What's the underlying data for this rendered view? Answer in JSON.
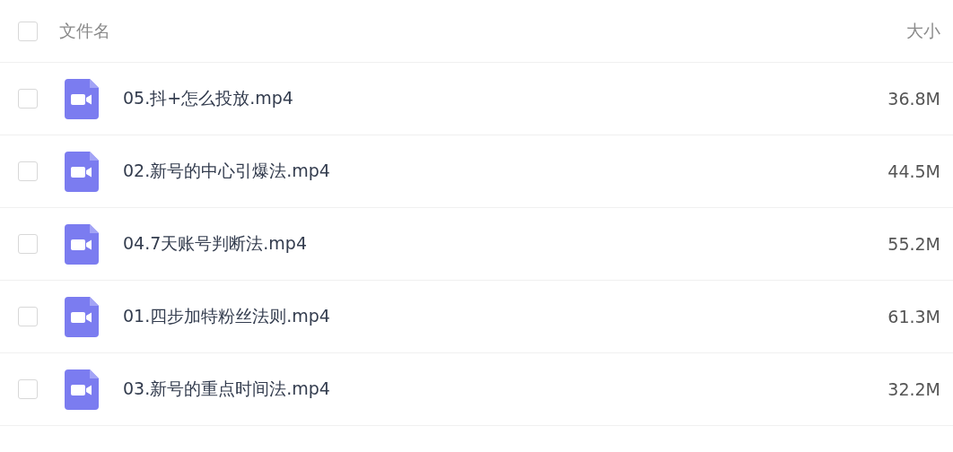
{
  "header": {
    "checked": false,
    "name_label": "文件名",
    "size_label": "大小"
  },
  "files": [
    {
      "name": "05.抖+怎么投放.mp4",
      "size": "36.8M",
      "kind": "video",
      "checked": false
    },
    {
      "name": "02.新号的中心引爆法.mp4",
      "size": "44.5M",
      "kind": "video",
      "checked": false
    },
    {
      "name": "04.7天账号判断法.mp4",
      "size": "55.2M",
      "kind": "video",
      "checked": false
    },
    {
      "name": "01.四步加特粉丝法则.mp4",
      "size": "61.3M",
      "kind": "video",
      "checked": false
    },
    {
      "name": "03.新号的重点时间法.mp4",
      "size": "32.2M",
      "kind": "video",
      "checked": false
    }
  ]
}
